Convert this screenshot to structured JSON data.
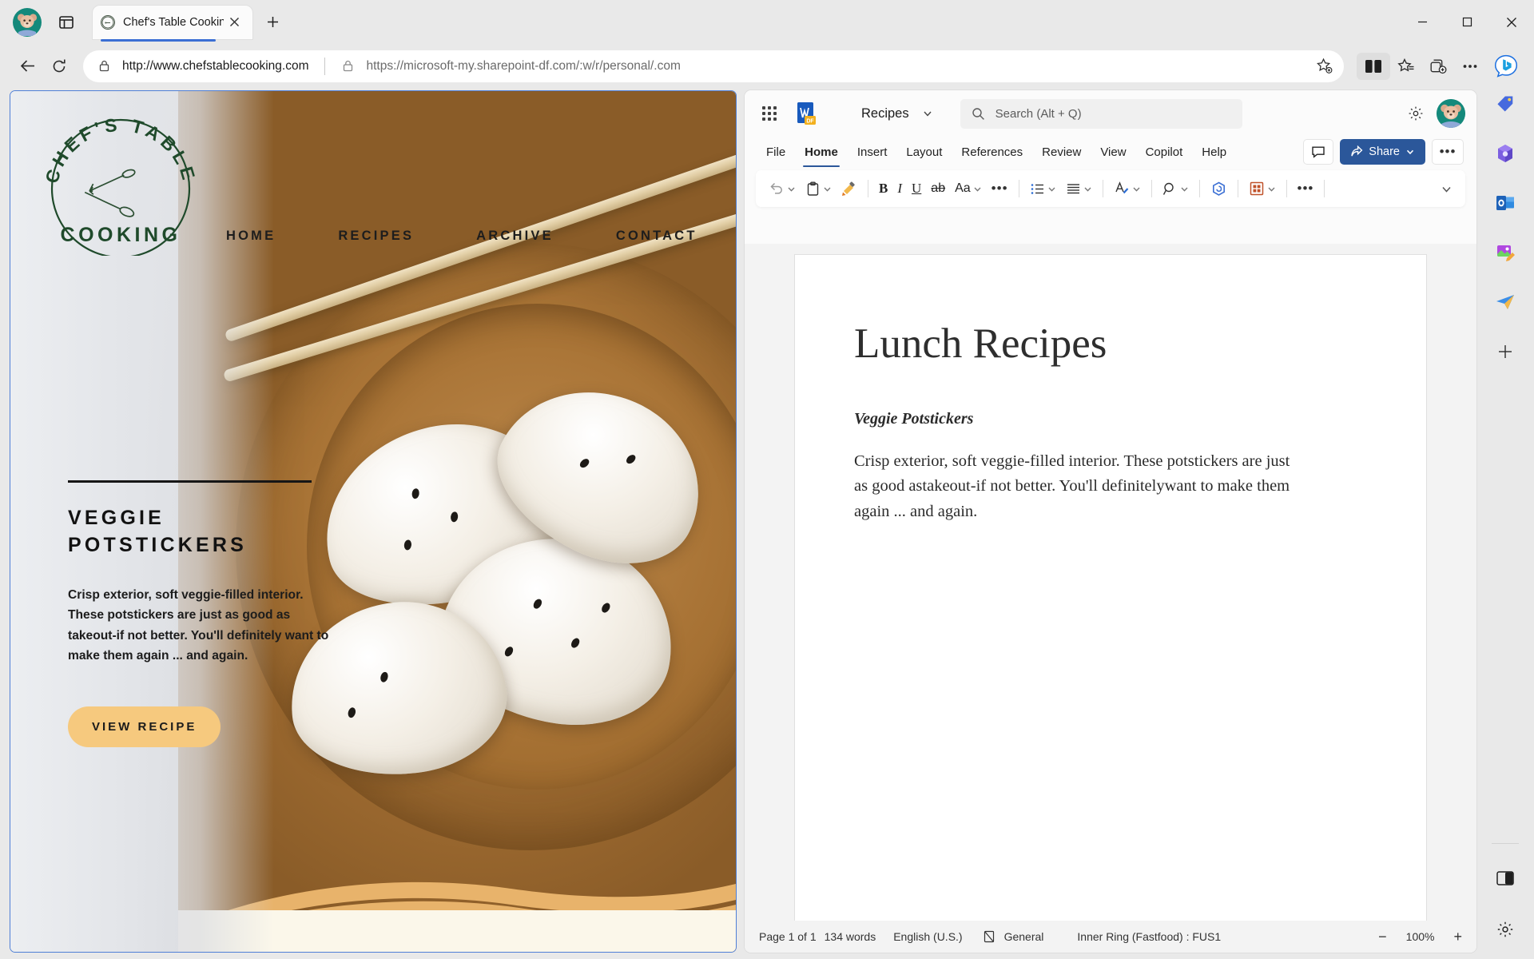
{
  "browser": {
    "tab": {
      "title": "Chef's Table Cooking",
      "favicon": "site-logo-favicon"
    },
    "new_tab_label": "+",
    "omnibox": {
      "url_primary": "http://www.chefstablecooking.com",
      "url_secondary": "https://microsoft-my.sharepoint-df.com/:w/r/personal/.com",
      "separator": "|"
    },
    "window_controls": {
      "minimize": "−",
      "maximize": "□",
      "close": "✕"
    },
    "toolbar_icons": [
      "back-icon",
      "refresh-icon",
      "favorite-add-icon",
      "split-screen-icon",
      "collections-star-icon",
      "copilot-tabs-icon",
      "browser-menu-icon",
      "bing-chat-icon"
    ],
    "sidebar_icons": [
      "shopping-tag-icon",
      "microsoft365-icon",
      "outlook-icon",
      "designer-icon",
      "send-plane-icon",
      "add-tool-icon",
      "split-pane-icon",
      "settings-gear-icon"
    ]
  },
  "website": {
    "logo": {
      "arc_text": "CHEF'S TABLE",
      "bottom_text": "COOKING"
    },
    "nav": [
      {
        "label": "HOME"
      },
      {
        "label": "RECIPES"
      },
      {
        "label": "ARCHIVE"
      },
      {
        "label": "CONTACT"
      }
    ],
    "hero": {
      "title": "VEGGIE POTSTICKERS",
      "body": "Crisp exterior, soft veggie-filled interior. These potstickers are just as good as takeout-if not better. You'll definitely want to make them again ... and again.",
      "cta_label": "VIEW RECIPE",
      "cta_color": "#f6c97e"
    }
  },
  "word": {
    "app_launcher": "waffle-icon",
    "document_name": "Recipes",
    "search": {
      "placeholder": "Search (Alt + Q)"
    },
    "ribbon_tabs": [
      {
        "label": "File",
        "active": false
      },
      {
        "label": "Home",
        "active": true
      },
      {
        "label": "Insert",
        "active": false
      },
      {
        "label": "Layout",
        "active": false
      },
      {
        "label": "References",
        "active": false
      },
      {
        "label": "Review",
        "active": false
      },
      {
        "label": "View",
        "active": false
      },
      {
        "label": "Copilot",
        "active": false
      },
      {
        "label": "Help",
        "active": false
      }
    ],
    "share": {
      "label": "Share",
      "color": "#2b579a"
    },
    "more_label": "•••",
    "toolbar_items": [
      "undo-icon",
      "paste-icon",
      "format-painter-icon",
      "bold-icon",
      "italic-icon",
      "underline-icon",
      "strikethrough-icon",
      "font-options-icon",
      "more-font-icon",
      "bullets-icon",
      "align-icon",
      "styles-icon",
      "find-icon",
      "copilot-icon",
      "table-icon",
      "overflow-icon",
      "collapse-ribbon-icon"
    ],
    "toolbar_labels": {
      "bold": "B",
      "italic": "I",
      "underline": "U",
      "strikethrough": "ab",
      "font": "Aa",
      "ellipsis": "•••"
    },
    "document": {
      "heading": "Lunch Recipes",
      "subheading": "Veggie Potstickers",
      "paragraph": "Crisp exterior, soft veggie-filled interior. These potstickers are just as good astakeout-if not better. You'll definitelywant to make them again ... and again."
    },
    "status": {
      "page": "Page 1 of 1",
      "words": "134 words",
      "language": "English (U.S.)",
      "style": "General",
      "ring": "Inner Ring (Fastfood) : FUS1",
      "zoom_out": "−",
      "zoom_level": "100%",
      "zoom_in": "+"
    }
  }
}
